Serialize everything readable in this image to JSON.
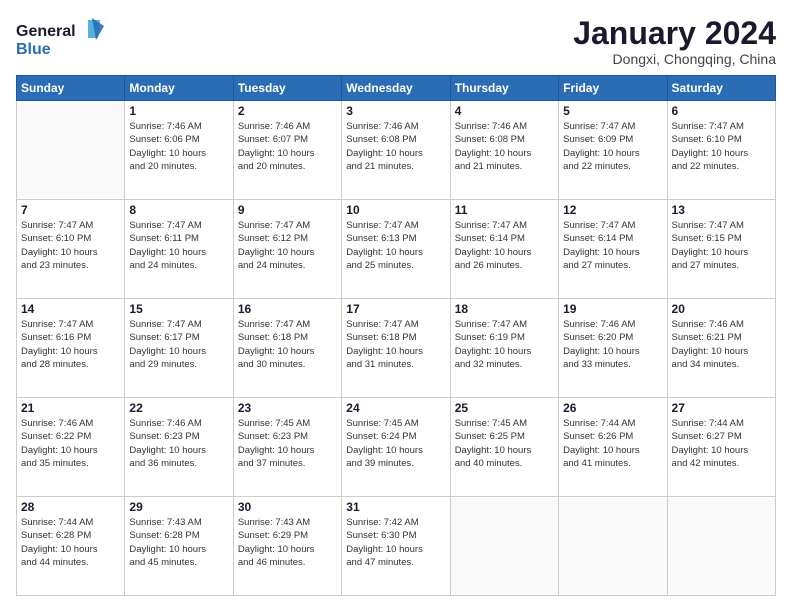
{
  "logo": {
    "line1": "General",
    "line2": "Blue"
  },
  "title": "January 2024",
  "location": "Dongxi, Chongqing, China",
  "days_header": [
    "Sunday",
    "Monday",
    "Tuesday",
    "Wednesday",
    "Thursday",
    "Friday",
    "Saturday"
  ],
  "weeks": [
    [
      {
        "num": "",
        "info": ""
      },
      {
        "num": "1",
        "info": "Sunrise: 7:46 AM\nSunset: 6:06 PM\nDaylight: 10 hours\nand 20 minutes."
      },
      {
        "num": "2",
        "info": "Sunrise: 7:46 AM\nSunset: 6:07 PM\nDaylight: 10 hours\nand 20 minutes."
      },
      {
        "num": "3",
        "info": "Sunrise: 7:46 AM\nSunset: 6:08 PM\nDaylight: 10 hours\nand 21 minutes."
      },
      {
        "num": "4",
        "info": "Sunrise: 7:46 AM\nSunset: 6:08 PM\nDaylight: 10 hours\nand 21 minutes."
      },
      {
        "num": "5",
        "info": "Sunrise: 7:47 AM\nSunset: 6:09 PM\nDaylight: 10 hours\nand 22 minutes."
      },
      {
        "num": "6",
        "info": "Sunrise: 7:47 AM\nSunset: 6:10 PM\nDaylight: 10 hours\nand 22 minutes."
      }
    ],
    [
      {
        "num": "7",
        "info": "Sunrise: 7:47 AM\nSunset: 6:10 PM\nDaylight: 10 hours\nand 23 minutes."
      },
      {
        "num": "8",
        "info": "Sunrise: 7:47 AM\nSunset: 6:11 PM\nDaylight: 10 hours\nand 24 minutes."
      },
      {
        "num": "9",
        "info": "Sunrise: 7:47 AM\nSunset: 6:12 PM\nDaylight: 10 hours\nand 24 minutes."
      },
      {
        "num": "10",
        "info": "Sunrise: 7:47 AM\nSunset: 6:13 PM\nDaylight: 10 hours\nand 25 minutes."
      },
      {
        "num": "11",
        "info": "Sunrise: 7:47 AM\nSunset: 6:14 PM\nDaylight: 10 hours\nand 26 minutes."
      },
      {
        "num": "12",
        "info": "Sunrise: 7:47 AM\nSunset: 6:14 PM\nDaylight: 10 hours\nand 27 minutes."
      },
      {
        "num": "13",
        "info": "Sunrise: 7:47 AM\nSunset: 6:15 PM\nDaylight: 10 hours\nand 27 minutes."
      }
    ],
    [
      {
        "num": "14",
        "info": "Sunrise: 7:47 AM\nSunset: 6:16 PM\nDaylight: 10 hours\nand 28 minutes."
      },
      {
        "num": "15",
        "info": "Sunrise: 7:47 AM\nSunset: 6:17 PM\nDaylight: 10 hours\nand 29 minutes."
      },
      {
        "num": "16",
        "info": "Sunrise: 7:47 AM\nSunset: 6:18 PM\nDaylight: 10 hours\nand 30 minutes."
      },
      {
        "num": "17",
        "info": "Sunrise: 7:47 AM\nSunset: 6:18 PM\nDaylight: 10 hours\nand 31 minutes."
      },
      {
        "num": "18",
        "info": "Sunrise: 7:47 AM\nSunset: 6:19 PM\nDaylight: 10 hours\nand 32 minutes."
      },
      {
        "num": "19",
        "info": "Sunrise: 7:46 AM\nSunset: 6:20 PM\nDaylight: 10 hours\nand 33 minutes."
      },
      {
        "num": "20",
        "info": "Sunrise: 7:46 AM\nSunset: 6:21 PM\nDaylight: 10 hours\nand 34 minutes."
      }
    ],
    [
      {
        "num": "21",
        "info": "Sunrise: 7:46 AM\nSunset: 6:22 PM\nDaylight: 10 hours\nand 35 minutes."
      },
      {
        "num": "22",
        "info": "Sunrise: 7:46 AM\nSunset: 6:23 PM\nDaylight: 10 hours\nand 36 minutes."
      },
      {
        "num": "23",
        "info": "Sunrise: 7:45 AM\nSunset: 6:23 PM\nDaylight: 10 hours\nand 37 minutes."
      },
      {
        "num": "24",
        "info": "Sunrise: 7:45 AM\nSunset: 6:24 PM\nDaylight: 10 hours\nand 39 minutes."
      },
      {
        "num": "25",
        "info": "Sunrise: 7:45 AM\nSunset: 6:25 PM\nDaylight: 10 hours\nand 40 minutes."
      },
      {
        "num": "26",
        "info": "Sunrise: 7:44 AM\nSunset: 6:26 PM\nDaylight: 10 hours\nand 41 minutes."
      },
      {
        "num": "27",
        "info": "Sunrise: 7:44 AM\nSunset: 6:27 PM\nDaylight: 10 hours\nand 42 minutes."
      }
    ],
    [
      {
        "num": "28",
        "info": "Sunrise: 7:44 AM\nSunset: 6:28 PM\nDaylight: 10 hours\nand 44 minutes."
      },
      {
        "num": "29",
        "info": "Sunrise: 7:43 AM\nSunset: 6:28 PM\nDaylight: 10 hours\nand 45 minutes."
      },
      {
        "num": "30",
        "info": "Sunrise: 7:43 AM\nSunset: 6:29 PM\nDaylight: 10 hours\nand 46 minutes."
      },
      {
        "num": "31",
        "info": "Sunrise: 7:42 AM\nSunset: 6:30 PM\nDaylight: 10 hours\nand 47 minutes."
      },
      {
        "num": "",
        "info": ""
      },
      {
        "num": "",
        "info": ""
      },
      {
        "num": "",
        "info": ""
      }
    ]
  ]
}
